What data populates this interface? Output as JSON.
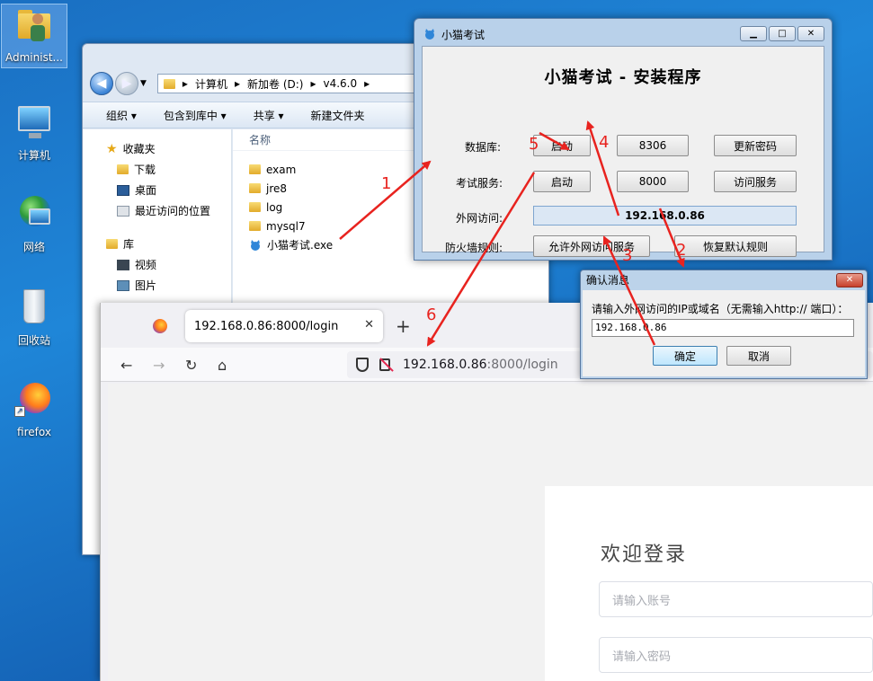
{
  "desktop": {
    "icons": [
      {
        "label": "Administ..."
      },
      {
        "label": "计算机"
      },
      {
        "label": "网络"
      },
      {
        "label": "回收站"
      },
      {
        "label": "firefox"
      }
    ]
  },
  "explorer": {
    "breadcrumb": [
      "计算机",
      "新加卷 (D:)",
      "v4.6.0"
    ],
    "toolbar": [
      "组织 ▾",
      "包含到库中 ▾",
      "共享 ▾",
      "新建文件夹"
    ],
    "nav": {
      "favorites": "收藏夹",
      "favorites_items": [
        "下载",
        "桌面",
        "最近访问的位置"
      ],
      "libraries": "库",
      "library_items": [
        "视频",
        "图片"
      ]
    },
    "column_name": "名称",
    "files": [
      "exam",
      "jre8",
      "log",
      "mysql7",
      "小猫考试.exe"
    ]
  },
  "installer": {
    "window_title": "小猫考试",
    "heading": "小猫考试 - 安装程序",
    "db_label": "数据库:",
    "db_start": "启动",
    "db_port": "8306",
    "db_update_pwd": "更新密码",
    "svc_label": "考试服务:",
    "svc_start": "启动",
    "svc_port": "8000",
    "svc_visit": "访问服务",
    "ext_label": "外网访问:",
    "ext_ip": "192.168.0.86",
    "fw_label": "防火墙规则:",
    "fw_allow": "允许外网访问服务",
    "fw_restore": "恢复默认规则"
  },
  "dialog": {
    "title": "确认消息",
    "prompt": "请输入外网访问的IP或域名（无需输入http:// 端口）：",
    "value": "192.168.0.86",
    "ok": "确定",
    "cancel": "取消"
  },
  "browser": {
    "tab_title": "192.168.0.86:8000/login",
    "url_host": "192.168.0.86",
    "url_rest": ":8000/login",
    "login_title": "欢迎登录",
    "username_placeholder": "请输入账号",
    "password_placeholder": "请输入密码"
  },
  "annotations": {
    "step_labels": [
      "1",
      "2",
      "3",
      "4",
      "5",
      "6"
    ],
    "arrow_color": "#e8231f"
  }
}
